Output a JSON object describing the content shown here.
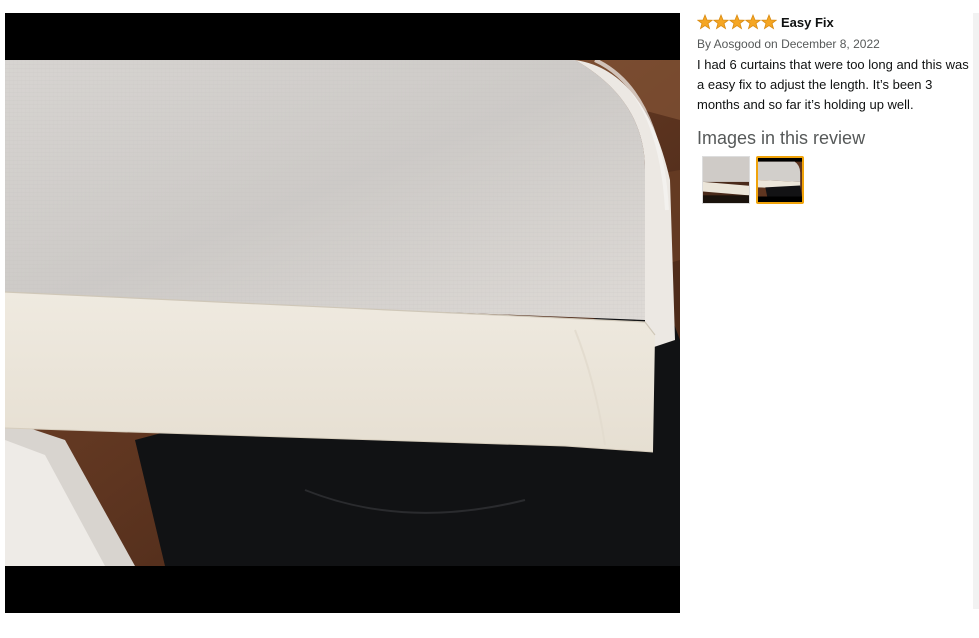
{
  "review": {
    "rating": 5,
    "title": "Easy Fix",
    "byline": "By Aosgood on December 8, 2022",
    "body": "I had 6 curtains that were too long and this was a easy fix to adjust the length. It’s been 3 months and so far it’s holding up well."
  },
  "images_section": {
    "heading": "Images in this review",
    "selected_index": 1
  },
  "colors": {
    "star": "#f5a623",
    "selected_border": "#f0a30a"
  },
  "icons": {
    "star": "star-icon"
  }
}
